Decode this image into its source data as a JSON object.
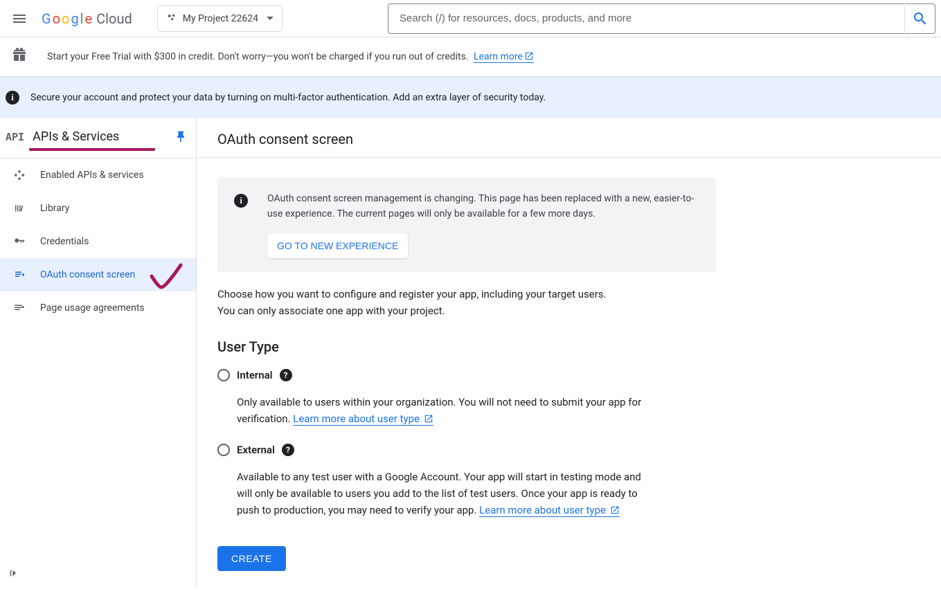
{
  "header": {
    "logo_text": "Cloud",
    "project_name": "My Project 22624",
    "search_placeholder": "Search (/) for resources, docs, products, and more"
  },
  "trial_banner": {
    "text": "Start your Free Trial with $300 in credit. Don't worry—you won't be charged if you run out of credits.",
    "link_text": "Learn more"
  },
  "mfa_banner": {
    "text": "Secure your account and protect your data by turning on multi-factor authentication. Add an extra layer of security today."
  },
  "sidebar": {
    "api_badge": "API",
    "title": "APIs & Services",
    "items": [
      {
        "label": "Enabled APIs & services"
      },
      {
        "label": "Library"
      },
      {
        "label": "Credentials"
      },
      {
        "label": "OAuth consent screen"
      },
      {
        "label": "Page usage agreements"
      }
    ]
  },
  "page": {
    "title": "OAuth consent screen",
    "notice": {
      "text": "OAuth consent screen management is changing. This page has been replaced with a new, easier-to-use experience. The current pages will only be available for a few more days.",
      "button": "GO TO NEW EXPERIENCE"
    },
    "description": "Choose how you want to configure and register your app, including your target users. You can only associate one app with your project.",
    "user_type_title": "User Type",
    "internal": {
      "label": "Internal",
      "desc": "Only available to users within your organization. You will not need to submit your app for verification. ",
      "link": "Learn more about user type"
    },
    "external": {
      "label": "External",
      "desc": "Available to any test user with a Google Account. Your app will start in testing mode and will only be available to users you add to the list of test users. Once your app is ready to push to production, you may need to verify your app. ",
      "link": "Learn more about user type"
    },
    "create_button": "CREATE"
  }
}
